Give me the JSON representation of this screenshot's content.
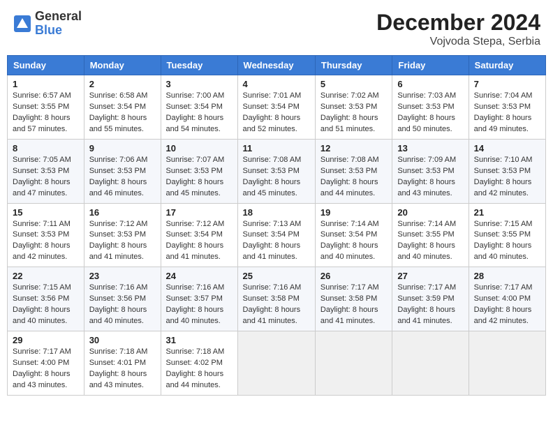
{
  "header": {
    "logo_general": "General",
    "logo_blue": "Blue",
    "month_title": "December 2024",
    "location": "Vojvoda Stepa, Serbia"
  },
  "weekdays": [
    "Sunday",
    "Monday",
    "Tuesday",
    "Wednesday",
    "Thursday",
    "Friday",
    "Saturday"
  ],
  "weeks": [
    [
      {
        "day": "1",
        "sunrise": "6:57 AM",
        "sunset": "3:55 PM",
        "daylight": "8 hours and 57 minutes."
      },
      {
        "day": "2",
        "sunrise": "6:58 AM",
        "sunset": "3:54 PM",
        "daylight": "8 hours and 55 minutes."
      },
      {
        "day": "3",
        "sunrise": "7:00 AM",
        "sunset": "3:54 PM",
        "daylight": "8 hours and 54 minutes."
      },
      {
        "day": "4",
        "sunrise": "7:01 AM",
        "sunset": "3:54 PM",
        "daylight": "8 hours and 52 minutes."
      },
      {
        "day": "5",
        "sunrise": "7:02 AM",
        "sunset": "3:53 PM",
        "daylight": "8 hours and 51 minutes."
      },
      {
        "day": "6",
        "sunrise": "7:03 AM",
        "sunset": "3:53 PM",
        "daylight": "8 hours and 50 minutes."
      },
      {
        "day": "7",
        "sunrise": "7:04 AM",
        "sunset": "3:53 PM",
        "daylight": "8 hours and 49 minutes."
      }
    ],
    [
      {
        "day": "8",
        "sunrise": "7:05 AM",
        "sunset": "3:53 PM",
        "daylight": "8 hours and 47 minutes."
      },
      {
        "day": "9",
        "sunrise": "7:06 AM",
        "sunset": "3:53 PM",
        "daylight": "8 hours and 46 minutes."
      },
      {
        "day": "10",
        "sunrise": "7:07 AM",
        "sunset": "3:53 PM",
        "daylight": "8 hours and 45 minutes."
      },
      {
        "day": "11",
        "sunrise": "7:08 AM",
        "sunset": "3:53 PM",
        "daylight": "8 hours and 45 minutes."
      },
      {
        "day": "12",
        "sunrise": "7:08 AM",
        "sunset": "3:53 PM",
        "daylight": "8 hours and 44 minutes."
      },
      {
        "day": "13",
        "sunrise": "7:09 AM",
        "sunset": "3:53 PM",
        "daylight": "8 hours and 43 minutes."
      },
      {
        "day": "14",
        "sunrise": "7:10 AM",
        "sunset": "3:53 PM",
        "daylight": "8 hours and 42 minutes."
      }
    ],
    [
      {
        "day": "15",
        "sunrise": "7:11 AM",
        "sunset": "3:53 PM",
        "daylight": "8 hours and 42 minutes."
      },
      {
        "day": "16",
        "sunrise": "7:12 AM",
        "sunset": "3:53 PM",
        "daylight": "8 hours and 41 minutes."
      },
      {
        "day": "17",
        "sunrise": "7:12 AM",
        "sunset": "3:54 PM",
        "daylight": "8 hours and 41 minutes."
      },
      {
        "day": "18",
        "sunrise": "7:13 AM",
        "sunset": "3:54 PM",
        "daylight": "8 hours and 41 minutes."
      },
      {
        "day": "19",
        "sunrise": "7:14 AM",
        "sunset": "3:54 PM",
        "daylight": "8 hours and 40 minutes."
      },
      {
        "day": "20",
        "sunrise": "7:14 AM",
        "sunset": "3:55 PM",
        "daylight": "8 hours and 40 minutes."
      },
      {
        "day": "21",
        "sunrise": "7:15 AM",
        "sunset": "3:55 PM",
        "daylight": "8 hours and 40 minutes."
      }
    ],
    [
      {
        "day": "22",
        "sunrise": "7:15 AM",
        "sunset": "3:56 PM",
        "daylight": "8 hours and 40 minutes."
      },
      {
        "day": "23",
        "sunrise": "7:16 AM",
        "sunset": "3:56 PM",
        "daylight": "8 hours and 40 minutes."
      },
      {
        "day": "24",
        "sunrise": "7:16 AM",
        "sunset": "3:57 PM",
        "daylight": "8 hours and 40 minutes."
      },
      {
        "day": "25",
        "sunrise": "7:16 AM",
        "sunset": "3:58 PM",
        "daylight": "8 hours and 41 minutes."
      },
      {
        "day": "26",
        "sunrise": "7:17 AM",
        "sunset": "3:58 PM",
        "daylight": "8 hours and 41 minutes."
      },
      {
        "day": "27",
        "sunrise": "7:17 AM",
        "sunset": "3:59 PM",
        "daylight": "8 hours and 41 minutes."
      },
      {
        "day": "28",
        "sunrise": "7:17 AM",
        "sunset": "4:00 PM",
        "daylight": "8 hours and 42 minutes."
      }
    ],
    [
      {
        "day": "29",
        "sunrise": "7:17 AM",
        "sunset": "4:00 PM",
        "daylight": "8 hours and 43 minutes."
      },
      {
        "day": "30",
        "sunrise": "7:18 AM",
        "sunset": "4:01 PM",
        "daylight": "8 hours and 43 minutes."
      },
      {
        "day": "31",
        "sunrise": "7:18 AM",
        "sunset": "4:02 PM",
        "daylight": "8 hours and 44 minutes."
      },
      null,
      null,
      null,
      null
    ]
  ]
}
